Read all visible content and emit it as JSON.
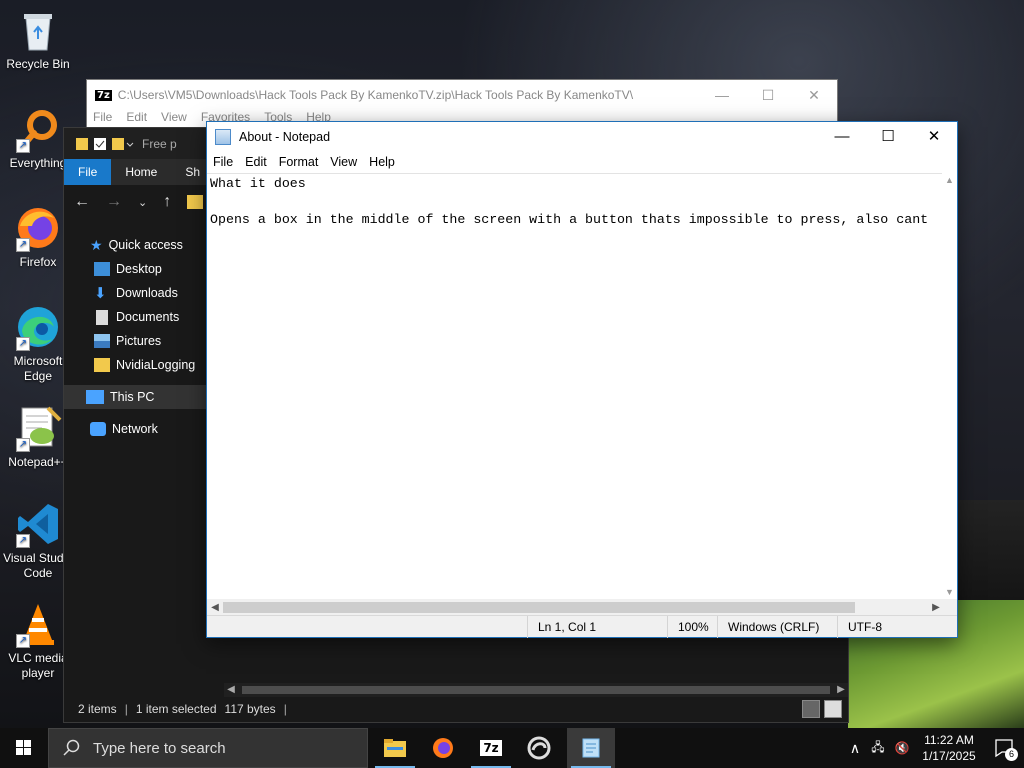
{
  "desktop": {
    "icons": [
      {
        "label": "Recycle Bin",
        "icon": "recycle-bin-icon"
      },
      {
        "label": "Everything",
        "icon": "everything-icon"
      },
      {
        "label": "Firefox",
        "icon": "firefox-icon"
      },
      {
        "label": "Microsoft Edge",
        "icon": "edge-icon"
      },
      {
        "label": "Notepad++",
        "icon": "notepadpp-icon"
      },
      {
        "label": "Visual Studio Code",
        "icon": "vscode-icon"
      },
      {
        "label": "VLC media player",
        "icon": "vlc-icon"
      }
    ]
  },
  "sevenzip": {
    "badge": "7z",
    "title": "C:\\Users\\VM5\\Downloads\\Hack Tools Pack By KamenkoTV.zip\\Hack Tools Pack By KamenkoTV\\",
    "menu": [
      "File",
      "Edit",
      "View",
      "Favorites",
      "Tools",
      "Help"
    ]
  },
  "explorer": {
    "title": "Free p",
    "ribbon": {
      "file": "File",
      "home": "Home",
      "share": "Sh"
    },
    "sidebar": [
      {
        "label": "Quick access",
        "icon": "star-icon"
      },
      {
        "label": "Desktop",
        "icon": "desktop-folder-icon"
      },
      {
        "label": "Downloads",
        "icon": "download-icon"
      },
      {
        "label": "Documents",
        "icon": "documents-icon"
      },
      {
        "label": "Pictures",
        "icon": "pictures-icon"
      },
      {
        "label": "NvidiaLogging",
        "icon": "folder-icon"
      },
      {
        "label": "This PC",
        "icon": "pc-icon"
      },
      {
        "label": "Network",
        "icon": "network-icon"
      }
    ],
    "status": {
      "items": "2 items",
      "selected": "1 item selected",
      "size": "117 bytes"
    }
  },
  "notepad": {
    "title": "About - Notepad",
    "menu": [
      "File",
      "Edit",
      "Format",
      "View",
      "Help"
    ],
    "content": "What it does\n\nOpens a box in the middle of the screen with a button thats impossible to press, also cant",
    "status": {
      "position": "Ln 1, Col 1",
      "zoom": "100%",
      "line_ending": "Windows (CRLF)",
      "encoding": "UTF-8"
    }
  },
  "taskbar": {
    "search_placeholder": "Type here to search",
    "apps": [
      "file-explorer-icon",
      "firefox-icon",
      "7zip-icon",
      "edge-beta-icon",
      "notepad-icon"
    ],
    "time": "11:22 AM",
    "date": "1/17/2025",
    "notifications": "6"
  },
  "colors": {
    "accent": "#1979ca",
    "taskbar": "#101010",
    "explorer_bg": "#191919"
  }
}
